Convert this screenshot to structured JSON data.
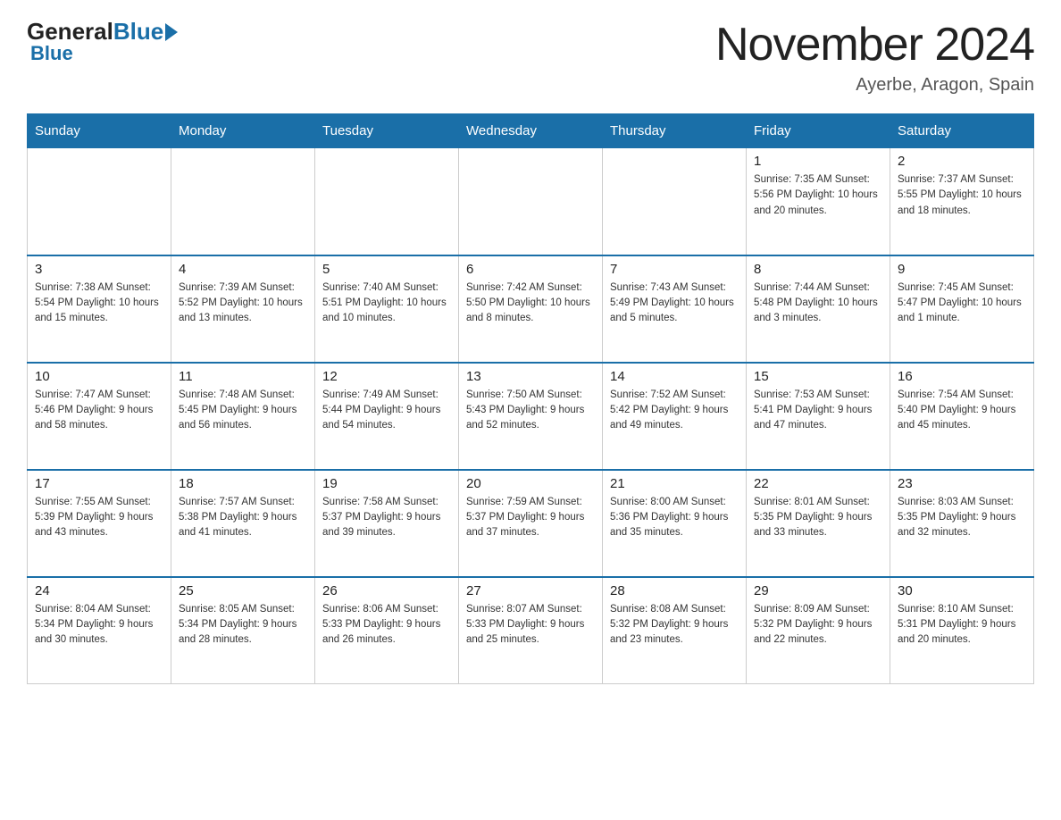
{
  "logo": {
    "text_general": "General",
    "text_blue": "Blue"
  },
  "title": "November 2024",
  "subtitle": "Ayerbe, Aragon, Spain",
  "days_of_week": [
    "Sunday",
    "Monday",
    "Tuesday",
    "Wednesday",
    "Thursday",
    "Friday",
    "Saturday"
  ],
  "weeks": [
    [
      {
        "day": "",
        "info": ""
      },
      {
        "day": "",
        "info": ""
      },
      {
        "day": "",
        "info": ""
      },
      {
        "day": "",
        "info": ""
      },
      {
        "day": "",
        "info": ""
      },
      {
        "day": "1",
        "info": "Sunrise: 7:35 AM\nSunset: 5:56 PM\nDaylight: 10 hours\nand 20 minutes."
      },
      {
        "day": "2",
        "info": "Sunrise: 7:37 AM\nSunset: 5:55 PM\nDaylight: 10 hours\nand 18 minutes."
      }
    ],
    [
      {
        "day": "3",
        "info": "Sunrise: 7:38 AM\nSunset: 5:54 PM\nDaylight: 10 hours\nand 15 minutes."
      },
      {
        "day": "4",
        "info": "Sunrise: 7:39 AM\nSunset: 5:52 PM\nDaylight: 10 hours\nand 13 minutes."
      },
      {
        "day": "5",
        "info": "Sunrise: 7:40 AM\nSunset: 5:51 PM\nDaylight: 10 hours\nand 10 minutes."
      },
      {
        "day": "6",
        "info": "Sunrise: 7:42 AM\nSunset: 5:50 PM\nDaylight: 10 hours\nand 8 minutes."
      },
      {
        "day": "7",
        "info": "Sunrise: 7:43 AM\nSunset: 5:49 PM\nDaylight: 10 hours\nand 5 minutes."
      },
      {
        "day": "8",
        "info": "Sunrise: 7:44 AM\nSunset: 5:48 PM\nDaylight: 10 hours\nand 3 minutes."
      },
      {
        "day": "9",
        "info": "Sunrise: 7:45 AM\nSunset: 5:47 PM\nDaylight: 10 hours\nand 1 minute."
      }
    ],
    [
      {
        "day": "10",
        "info": "Sunrise: 7:47 AM\nSunset: 5:46 PM\nDaylight: 9 hours\nand 58 minutes."
      },
      {
        "day": "11",
        "info": "Sunrise: 7:48 AM\nSunset: 5:45 PM\nDaylight: 9 hours\nand 56 minutes."
      },
      {
        "day": "12",
        "info": "Sunrise: 7:49 AM\nSunset: 5:44 PM\nDaylight: 9 hours\nand 54 minutes."
      },
      {
        "day": "13",
        "info": "Sunrise: 7:50 AM\nSunset: 5:43 PM\nDaylight: 9 hours\nand 52 minutes."
      },
      {
        "day": "14",
        "info": "Sunrise: 7:52 AM\nSunset: 5:42 PM\nDaylight: 9 hours\nand 49 minutes."
      },
      {
        "day": "15",
        "info": "Sunrise: 7:53 AM\nSunset: 5:41 PM\nDaylight: 9 hours\nand 47 minutes."
      },
      {
        "day": "16",
        "info": "Sunrise: 7:54 AM\nSunset: 5:40 PM\nDaylight: 9 hours\nand 45 minutes."
      }
    ],
    [
      {
        "day": "17",
        "info": "Sunrise: 7:55 AM\nSunset: 5:39 PM\nDaylight: 9 hours\nand 43 minutes."
      },
      {
        "day": "18",
        "info": "Sunrise: 7:57 AM\nSunset: 5:38 PM\nDaylight: 9 hours\nand 41 minutes."
      },
      {
        "day": "19",
        "info": "Sunrise: 7:58 AM\nSunset: 5:37 PM\nDaylight: 9 hours\nand 39 minutes."
      },
      {
        "day": "20",
        "info": "Sunrise: 7:59 AM\nSunset: 5:37 PM\nDaylight: 9 hours\nand 37 minutes."
      },
      {
        "day": "21",
        "info": "Sunrise: 8:00 AM\nSunset: 5:36 PM\nDaylight: 9 hours\nand 35 minutes."
      },
      {
        "day": "22",
        "info": "Sunrise: 8:01 AM\nSunset: 5:35 PM\nDaylight: 9 hours\nand 33 minutes."
      },
      {
        "day": "23",
        "info": "Sunrise: 8:03 AM\nSunset: 5:35 PM\nDaylight: 9 hours\nand 32 minutes."
      }
    ],
    [
      {
        "day": "24",
        "info": "Sunrise: 8:04 AM\nSunset: 5:34 PM\nDaylight: 9 hours\nand 30 minutes."
      },
      {
        "day": "25",
        "info": "Sunrise: 8:05 AM\nSunset: 5:34 PM\nDaylight: 9 hours\nand 28 minutes."
      },
      {
        "day": "26",
        "info": "Sunrise: 8:06 AM\nSunset: 5:33 PM\nDaylight: 9 hours\nand 26 minutes."
      },
      {
        "day": "27",
        "info": "Sunrise: 8:07 AM\nSunset: 5:33 PM\nDaylight: 9 hours\nand 25 minutes."
      },
      {
        "day": "28",
        "info": "Sunrise: 8:08 AM\nSunset: 5:32 PM\nDaylight: 9 hours\nand 23 minutes."
      },
      {
        "day": "29",
        "info": "Sunrise: 8:09 AM\nSunset: 5:32 PM\nDaylight: 9 hours\nand 22 minutes."
      },
      {
        "day": "30",
        "info": "Sunrise: 8:10 AM\nSunset: 5:31 PM\nDaylight: 9 hours\nand 20 minutes."
      }
    ]
  ]
}
